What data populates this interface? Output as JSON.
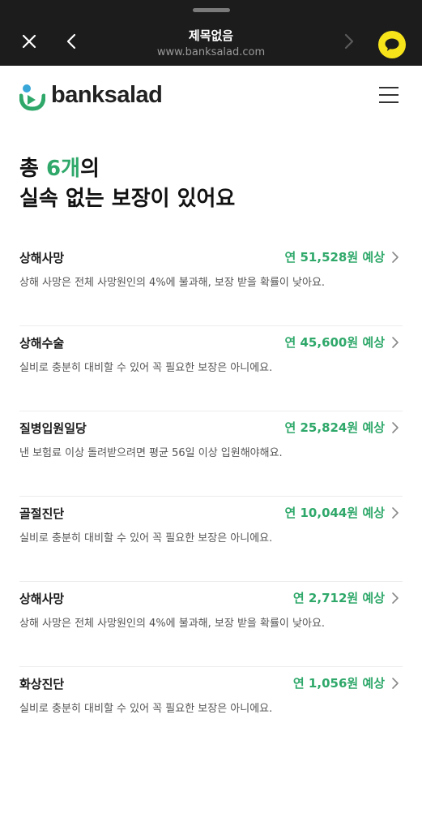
{
  "browser": {
    "title": "제목없음",
    "url": "www.banksalad.com"
  },
  "brand": {
    "name": "banksalad"
  },
  "headline": {
    "line1_prefix": "총 ",
    "line1_accent": "6개",
    "line1_suffix": "의",
    "line2": "실속 없는 보장이 있어요"
  },
  "items": [
    {
      "name": "상해사망",
      "amount": "연 51,528원 예상",
      "desc": "상해 사망은 전체 사망원인의 4%에 불과해, 보장 받을 확률이 낮아요."
    },
    {
      "name": "상해수술",
      "amount": "연 45,600원 예상",
      "desc": "실비로 충분히 대비할 수 있어 꼭 필요한 보장은 아니에요."
    },
    {
      "name": "질병입원일당",
      "amount": "연 25,824원 예상",
      "desc": "낸 보험료 이상 돌려받으려면 평균 56일 이상 입원해야해요."
    },
    {
      "name": "골절진단",
      "amount": "연 10,044원 예상",
      "desc": "실비로 충분히 대비할 수 있어 꼭 필요한 보장은 아니에요."
    },
    {
      "name": "상해사망",
      "amount": "연 2,712원 예상",
      "desc": "상해 사망은 전체 사망원인의 4%에 불과해, 보장 받을 확률이 낮아요."
    },
    {
      "name": "화상진단",
      "amount": "연 1,056원 예상",
      "desc": "실비로 충분히 대비할 수 있어 꼭 필요한 보장은 아니에요."
    }
  ],
  "colors": {
    "accent": "#2fa86a",
    "topbar": "#1c1c1c",
    "chat_button": "#f7e31a"
  }
}
